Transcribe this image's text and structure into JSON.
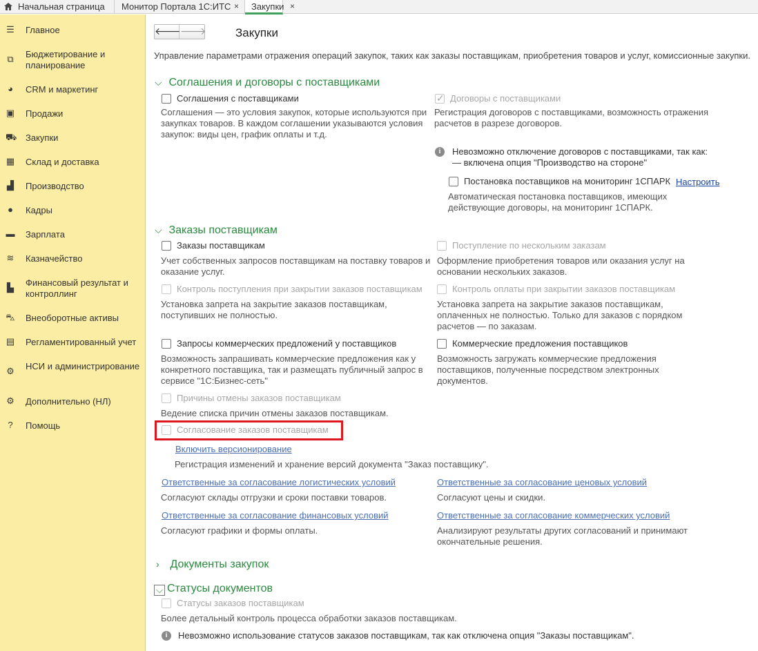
{
  "tabs": {
    "home": "Начальная страница",
    "monitor": "Монитор Портала 1С:ИТС",
    "current": "Закупки",
    "close_glyph": "×"
  },
  "sidebar": {
    "items": [
      {
        "label": "Главное",
        "icon": "menu-lines-icon"
      },
      {
        "label": "Бюджетирование и планирование",
        "icon": "budget-chart-icon"
      },
      {
        "label": "CRM и маркетинг",
        "icon": "pie-chart-icon"
      },
      {
        "label": "Продажи",
        "icon": "shopping-bag-icon"
      },
      {
        "label": "Закупки",
        "icon": "cart-icon"
      },
      {
        "label": "Склад и доставка",
        "icon": "warehouse-grid-icon"
      },
      {
        "label": "Производство",
        "icon": "factory-icon"
      },
      {
        "label": "Кадры",
        "icon": "person-icon"
      },
      {
        "label": "Зарплата",
        "icon": "wallet-icon"
      },
      {
        "label": "Казначейство",
        "icon": "coins-icon"
      },
      {
        "label": "Финансовый результат и контроллинг",
        "icon": "bar-chart-icon"
      },
      {
        "label": "Внеоборотные активы",
        "icon": "car-icon"
      },
      {
        "label": "Регламентированный учет",
        "icon": "calculator-icon"
      },
      {
        "label": "НСИ и администрирование",
        "icon": "gear-icon"
      },
      {
        "label": "Дополнительно (НЛ)",
        "icon": "gear-outline-icon"
      },
      {
        "label": "Помощь",
        "icon": "help-icon"
      }
    ]
  },
  "header": {
    "back": "🡐",
    "forward": "🡒",
    "title": "Закупки",
    "description": "Управление параметрами отражения операций закупок, таких как заказы поставщикам, приобретения товаров и услуг, комиссионные закупки."
  },
  "sections": {
    "agreements": {
      "title": "Соглашения и договоры с поставщиками",
      "cb_agreements": "Соглашения с поставщиками",
      "cb_agreements_desc": "Соглашения — это условия закупок, которые используются при закупках товаров. В каждом соглашении указываются условия закупок: виды цен, график оплаты и т.д.",
      "cb_contracts": "Договоры с поставщиками",
      "cb_contracts_desc": "Регистрация договоров с поставщиками, возможность отражения расчетов в разрезе договоров.",
      "info_line1": "Невозможно отключение договоров с поставщиками, так как:",
      "info_line2": "— включена опция \"Производство на стороне\"",
      "cb_monitoring": "Постановка поставщиков на мониторинг 1СПАРК",
      "configure_link": "Настроить",
      "cb_monitoring_desc": "Автоматическая постановка поставщиков, имеющих действующие договоры, на мониторинг 1СПАРК."
    },
    "orders": {
      "title": "Заказы поставщикам",
      "cb_orders": "Заказы поставщикам",
      "cb_orders_desc": "Учет собственных запросов поставщикам на поставку товаров и оказание услуг.",
      "cb_receipt_multi": "Поступление по нескольким заказам",
      "cb_receipt_multi_desc": "Оформление приобретения товаров или оказания услуг на основании нескольких заказов.",
      "cb_control_receipt": "Контроль поступления при закрытии заказов поставщикам",
      "cb_control_receipt_desc": "Установка запрета на закрытие заказов поставщикам, поступивших не полностью.",
      "cb_control_payment": "Контроль оплаты при закрытии заказов поставщикам",
      "cb_control_payment_desc": "Установка запрета на закрытие заказов поставщикам, оплаченных не полностью. Только для заказов с порядком расчетов — по заказам.",
      "cb_requests": "Запросы коммерческих предложений у поставщиков",
      "cb_requests_desc": "Возможность запрашивать коммерческие предложения как у конкретного поставщика, так и размещать публичный запрос в сервисе \"1С:Бизнес-сеть\"",
      "cb_offers": "Коммерческие предложения поставщиков",
      "cb_offers_desc": "Возможность загружать коммерческие предложения поставщиков, полученные посредством электронных документов.",
      "cb_cancel_reasons": "Причины отмены заказов поставщикам",
      "cb_cancel_reasons_desc": "Ведение списка причин отмены заказов поставщикам.",
      "cb_approval": "Согласование заказов поставщикам",
      "versioning_link": "Включить версионирование",
      "versioning_desc": "Регистрация изменений и хранение версий документа \"Заказ поставщику\".",
      "link_logistics": "Ответственные за согласование логистических условий",
      "link_logistics_desc": "Согласуют склады отгрузки и сроки поставки товаров.",
      "link_prices": "Ответственные за согласование ценовых условий",
      "link_prices_desc": "Согласуют цены и скидки.",
      "link_finance": "Ответственные за согласование финансовых условий",
      "link_finance_desc": "Согласуют графики и формы оплаты.",
      "link_commercial": "Ответственные за согласование коммерческих условий",
      "link_commercial_desc": "Анализируют результаты других согласований и принимают окончательные решения."
    },
    "documents": {
      "title": "Документы закупок"
    },
    "statuses": {
      "title": "Статусы документов",
      "cb_statuses": "Статусы заказов поставщикам",
      "cb_statuses_desc": "Более детальный контроль процесса обработки заказов поставщикам.",
      "info": "Невозможно использование статусов заказов поставщикам, так как отключена опция \"Заказы поставщикам\"."
    }
  },
  "colors": {
    "sidebar_bg": "#fbeda3",
    "section_title": "#2a8a3e",
    "link": "#4a6fb5",
    "highlight_border": "#e0161e"
  }
}
